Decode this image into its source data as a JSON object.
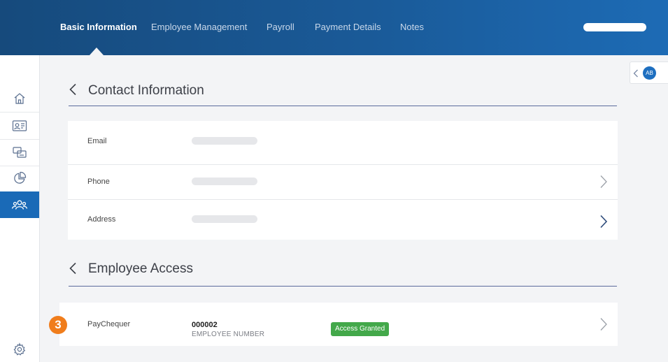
{
  "header": {
    "tabs": [
      {
        "label": "Basic Information",
        "active": true
      },
      {
        "label": "Employee Management",
        "active": false
      },
      {
        "label": "Payroll",
        "active": false
      },
      {
        "label": "Payment Details",
        "active": false
      },
      {
        "label": "Notes",
        "active": false
      }
    ],
    "colors": {
      "bar_start": "#164a7c",
      "bar_end": "#1d6bb5"
    }
  },
  "sidebar": {
    "items": [
      {
        "icon": "home-icon",
        "active": false
      },
      {
        "icon": "contact-card-icon",
        "active": false
      },
      {
        "icon": "devices-icon",
        "active": false
      },
      {
        "icon": "pie-chart-icon",
        "active": false
      },
      {
        "icon": "people-icon",
        "active": true
      }
    ],
    "bottom_icon": "gear-icon",
    "active_color": "#1a6ab7"
  },
  "contact": {
    "title": "Contact Information",
    "rows": [
      {
        "label": "Email"
      },
      {
        "label": "Phone"
      },
      {
        "label": "Address"
      }
    ]
  },
  "access": {
    "title": "Employee Access",
    "step": "3",
    "row": {
      "label": "PayChequer",
      "number": "000002",
      "number_caption": "EMPLOYEE NUMBER",
      "status": "Access Granted",
      "status_color": "#43a84a"
    }
  },
  "user": {
    "initials": "AB"
  }
}
